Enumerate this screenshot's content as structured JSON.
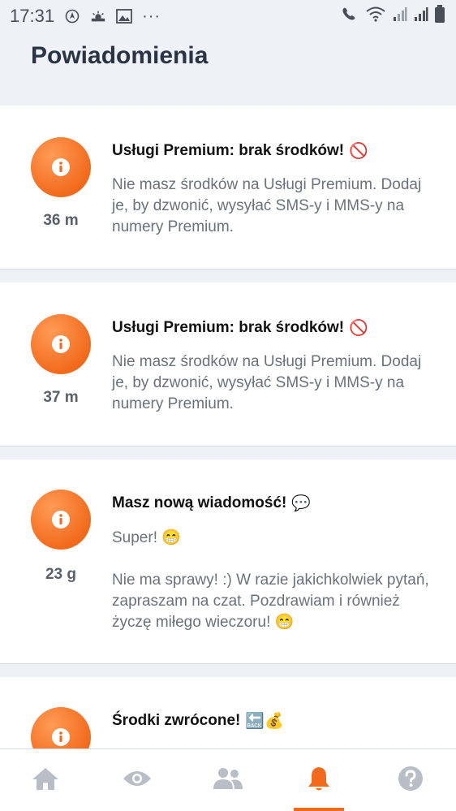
{
  "status_bar": {
    "time": "17:31",
    "dots": "···"
  },
  "header": {
    "title": "Powiadomienia"
  },
  "notifications": [
    {
      "title": "Usługi Premium: brak środków!",
      "title_emoji": "🚫",
      "time": "36 m",
      "body": "Nie masz środków na Usługi Premium. Dodaj je, by dzwonić, wysyłać SMS-y i MMS-y na numery Premium."
    },
    {
      "title": "Usługi Premium: brak środków!",
      "title_emoji": "🚫",
      "time": "37 m",
      "body": "Nie masz środków na Usługi Premium. Dodaj je, by dzwonić, wysyłać SMS-y i MMS-y na numery Premium."
    },
    {
      "title": "Masz nową wiadomość!",
      "title_emoji": "💬",
      "time": "23 g",
      "body_line1": "Super! 😁",
      "body": "Nie ma sprawy! :) W razie jakichkolwiek pytań, zapraszam na czat. Pozdrawiam i również życzę miłego wieczoru! 😁"
    },
    {
      "title": "Środki zwrócone!",
      "title_emoji": "🔙💰"
    }
  ],
  "tabs": [
    {
      "icon": "home-icon",
      "active": false
    },
    {
      "icon": "eye-icon",
      "active": false
    },
    {
      "icon": "people-icon",
      "active": false
    },
    {
      "icon": "bell-icon",
      "active": true
    },
    {
      "icon": "help-icon",
      "active": false
    }
  ],
  "colors": {
    "accent": "#f26b1d",
    "inactive": "#b9bec6",
    "title": "#2b3444"
  }
}
